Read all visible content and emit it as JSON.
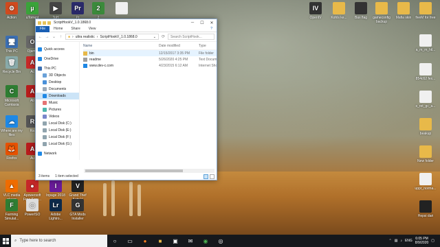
{
  "desktop_left": [
    {
      "label": "Action",
      "glyph": "⚙",
      "color": "#d04a1e"
    },
    {
      "label": "uTorrent",
      "glyph": "µ",
      "color": "#3aa33a"
    },
    {
      "label": "ToH",
      "glyph": "▶",
      "color": "#444"
    },
    {
      "label": "Pr",
      "glyph": "Pr",
      "color": "#2a2a6a"
    },
    {
      "label": "2",
      "glyph": "2",
      "color": "#3b8a3b"
    },
    {
      "label": "",
      "glyph": "",
      "color": "#f0f0f0"
    },
    {
      "label": "This PC",
      "glyph": "🖥",
      "color": "#3b6fb3"
    },
    {
      "label": "Ojama",
      "glyph": "O",
      "color": "#666"
    },
    {
      "label": "Recycle Bin",
      "glyph": "🗑",
      "color": "#8aa"
    },
    {
      "label": "Ac",
      "glyph": "A",
      "color": "#c62828"
    },
    {
      "label": "Microsoft Camtasia",
      "glyph": "C",
      "color": "#2e7d32"
    },
    {
      "label": "Ab",
      "glyph": "A",
      "color": "#b71c1c"
    },
    {
      "label": "Where are my files",
      "glyph": "☁",
      "color": "#1e88e5"
    },
    {
      "label": "Ra",
      "glyph": "R",
      "color": "#555"
    },
    {
      "label": "Firefox",
      "glyph": "🦊",
      "color": "#e65100"
    },
    {
      "label": "Au",
      "glyph": "A",
      "color": "#b71c1c"
    },
    {
      "label": "VLC media player",
      "glyph": "▲",
      "color": "#ef6c00"
    },
    {
      "label": "Apowersoft Free Scre...",
      "glyph": "●",
      "color": "#c62828"
    },
    {
      "label": "Inpage 2018",
      "glyph": "I",
      "color": "#6a1b9a"
    },
    {
      "label": "Grand Thef Auto V",
      "glyph": "V",
      "color": "#222"
    },
    {
      "label": "Farming Simulat...",
      "glyph": "F",
      "color": "#2e7d32"
    },
    {
      "label": "PowerISO",
      "glyph": "◎",
      "color": "#ddd"
    },
    {
      "label": "Adobe Lightro...",
      "glyph": "Lr",
      "color": "#0d2a4a"
    },
    {
      "label": "GTA Mods Installer",
      "glyph": "G",
      "color": "#333"
    }
  ],
  "desktop_right": [
    {
      "label": "OpenIV",
      "glyph": "IV",
      "color": "#333"
    },
    {
      "label": "Kohls ke...",
      "glyph": "",
      "color": "#e8b949"
    },
    {
      "label": "Bax flag",
      "glyph": "",
      "color": "#333"
    },
    {
      "label": "gameconfig backup",
      "glyph": "",
      "color": "#e8b949"
    },
    {
      "label": "Mafia skin",
      "glyph": "",
      "color": "#e8b949"
    },
    {
      "label": "fiveM for free",
      "glyph": "",
      "color": "#e8b949"
    },
    {
      "label": "a_m_m_hil...",
      "glyph": "",
      "color": "#f0f0f0"
    },
    {
      "label": "854c62 fex...",
      "glyph": "",
      "color": "#f0f0f0"
    },
    {
      "label": "s_ret_gc_a...",
      "glyph": "",
      "color": "#f0f0f0"
    },
    {
      "label": "beakup",
      "glyph": "",
      "color": "#e8b949"
    },
    {
      "label": "New folder",
      "glyph": "",
      "color": "#e8b949"
    },
    {
      "label": "uppr_norma...",
      "glyph": "",
      "color": "#f0f0f0"
    },
    {
      "label": "Hepsi dari",
      "glyph": "",
      "color": "#222"
    }
  ],
  "window": {
    "title": "ScriptHookV_1.0.1868.0",
    "ribbon": [
      "File",
      "Home",
      "Share",
      "View"
    ],
    "breadcrumb": [
      "ultra realistic",
      "ScriptHookV_1.0.1868.0"
    ],
    "search_placeholder": "Search ScriptHook...",
    "nav": [
      {
        "label": "Quick access",
        "color": "#1e88e5"
      },
      {
        "label": "OneDrive",
        "color": "#1e88e5"
      },
      {
        "label": "This PC",
        "color": "#3b6fb3"
      },
      {
        "label": "3D Objects",
        "color": "#6aa1d8"
      },
      {
        "label": "Desktop",
        "color": "#4a90d9"
      },
      {
        "label": "Documents",
        "color": "#9aa9b8"
      },
      {
        "label": "Downloads",
        "color": "#1e88e5"
      },
      {
        "label": "Music",
        "color": "#e57373"
      },
      {
        "label": "Pictures",
        "color": "#4db6ac"
      },
      {
        "label": "Videos",
        "color": "#7986cb"
      },
      {
        "label": "Local Disk (C:)",
        "color": "#90a4ae"
      },
      {
        "label": "Local Disk (E:)",
        "color": "#90a4ae"
      },
      {
        "label": "Local Disk (F:)",
        "color": "#90a4ae"
      },
      {
        "label": "Local Disk (G:)",
        "color": "#90a4ae"
      },
      {
        "label": "Network",
        "color": "#1e88e5"
      }
    ],
    "columns": {
      "name": "Name",
      "date": "Date modified",
      "type": "Type"
    },
    "files": [
      {
        "name": "bin",
        "date": "12/15/2017 3:35 PM",
        "type": "File folder",
        "icon": "folder"
      },
      {
        "name": "readme",
        "date": "5/26/2020 4:25 PM",
        "type": "Text Document",
        "icon": "text"
      },
      {
        "name": "www.dev-c.com",
        "date": "4/23/2015 6:12 AM",
        "type": "Internet Shortcut",
        "icon": "web"
      }
    ],
    "status_count": "3 items",
    "status_selected": "1 item selected"
  },
  "taskbar": {
    "search_placeholder": "Type here to search",
    "time": "6:05 PM",
    "date": "8/9/2020",
    "language": "ENG"
  }
}
